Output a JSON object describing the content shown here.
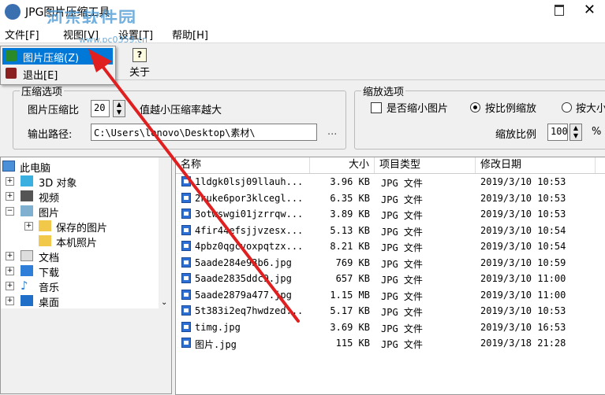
{
  "window": {
    "title": "JPG图片压缩工具",
    "watermark": "河东软件园",
    "watermark_url": "www.pc0359.cn"
  },
  "menu": {
    "items": [
      "文件[F]",
      "视图[V]",
      "设置[T]",
      "帮助[H]"
    ]
  },
  "toolbar": {
    "about_label": "关于"
  },
  "dropdown": {
    "items": [
      "图片压缩(Z)",
      "退出[E]"
    ]
  },
  "compress": {
    "group_title": "压缩选项",
    "ratio_label": "图片压缩比",
    "ratio_value": "20",
    "ratio_hint": "值越小压缩率越大",
    "output_label": "输出路径:",
    "output_value": "C:\\Users\\lenovo\\Desktop\\素材\\",
    "browse_label": "..."
  },
  "scale": {
    "group_title": "缩放选项",
    "shrink_label": "是否缩小图片",
    "shrink_checked": false,
    "radio_ratio_label": "按比例缩放",
    "radio_size_label": "按大小",
    "scale_ratio_label": "缩放比例",
    "scale_ratio_value": "100",
    "percent": "%"
  },
  "tree": {
    "nodes": [
      {
        "label": "此电脑",
        "level": 0,
        "icon": "pc-icon"
      },
      {
        "label": "3D 对象",
        "level": 1,
        "icon": "cube-icon"
      },
      {
        "label": "视频",
        "level": 1,
        "icon": "video-icon"
      },
      {
        "label": "图片",
        "level": 1,
        "icon": "picture-icon"
      },
      {
        "label": "保存的图片",
        "level": 2,
        "icon": "folder-icon"
      },
      {
        "label": "本机照片",
        "level": 2,
        "icon": "folder-icon"
      },
      {
        "label": "文档",
        "level": 1,
        "icon": "document-icon"
      },
      {
        "label": "下载",
        "level": 1,
        "icon": "download-icon"
      },
      {
        "label": "音乐",
        "level": 1,
        "icon": "music-icon"
      },
      {
        "label": "桌面",
        "level": 1,
        "icon": "desktop-icon"
      }
    ]
  },
  "list": {
    "columns": [
      "名称",
      "大小",
      "项目类型",
      "修改日期"
    ],
    "rows": [
      {
        "name": "1ldgk0lsj09llauh...",
        "size": "3.96 KB",
        "type": "JPG 文件",
        "date": "2019/3/10 10:53"
      },
      {
        "name": "2kuke6por3klcegl...",
        "size": "6.35 KB",
        "type": "JPG 文件",
        "date": "2019/3/10 10:53"
      },
      {
        "name": "3otwswgi01jzrrqw...",
        "size": "3.89 KB",
        "type": "JPG 文件",
        "date": "2019/3/10 10:53"
      },
      {
        "name": "4fir44efsjjvzesx...",
        "size": "5.13 KB",
        "type": "JPG 文件",
        "date": "2019/3/10 10:54"
      },
      {
        "name": "4pbz0qgcvoxpqtzx...",
        "size": "8.21 KB",
        "type": "JPG 文件",
        "date": "2019/3/10 10:54"
      },
      {
        "name": "5aade284e93b6.jpg",
        "size": "769 KB",
        "type": "JPG 文件",
        "date": "2019/3/10 10:59"
      },
      {
        "name": "5aade2835ddc9.jpg",
        "size": "657 KB",
        "type": "JPG 文件",
        "date": "2019/3/10 11:00"
      },
      {
        "name": "5aade2879a477.jpg",
        "size": "1.15 MB",
        "type": "JPG 文件",
        "date": "2019/3/10 11:00"
      },
      {
        "name": "5t383i2eq7hwdzed...",
        "size": "5.17 KB",
        "type": "JPG 文件",
        "date": "2019/3/10 10:53"
      },
      {
        "name": "timg.jpg",
        "size": "3.69 KB",
        "type": "JPG 文件",
        "date": "2019/3/10 16:53"
      },
      {
        "name": "图片.jpg",
        "size": "115 KB",
        "type": "JPG 文件",
        "date": "2019/3/18 21:28"
      }
    ]
  },
  "colors": {
    "selection": "#0078d7",
    "annotation_arrow": "#e02020",
    "file_icon": "#2b6fd6"
  }
}
